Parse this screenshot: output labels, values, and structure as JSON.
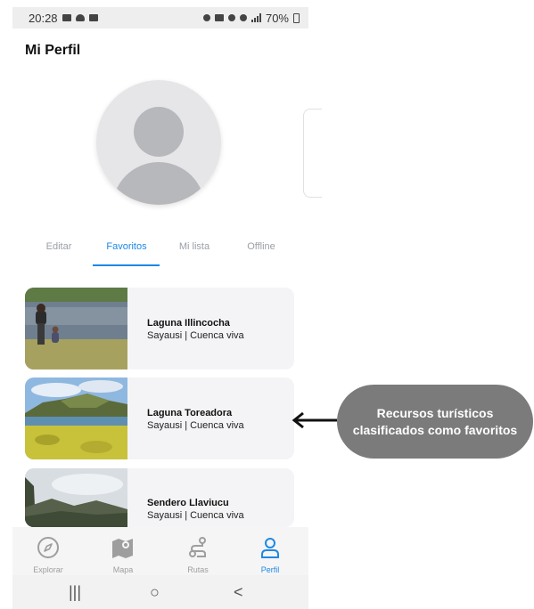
{
  "status_bar": {
    "time": "20:28",
    "battery": "70%"
  },
  "page_title": "Mi Perfil",
  "tabs": [
    {
      "label": "Editar",
      "active": false
    },
    {
      "label": "Favoritos",
      "active": true
    },
    {
      "label": "Mi lista",
      "active": false
    },
    {
      "label": "Offline",
      "active": false
    }
  ],
  "favorites": [
    {
      "title": "Laguna Illincocha",
      "subtitle": "Sayausi | Cuenca viva"
    },
    {
      "title": "Laguna Toreadora",
      "subtitle": "Sayausi | Cuenca viva"
    },
    {
      "title": "Sendero Llaviucu",
      "subtitle": "Sayausi | Cuenca viva"
    }
  ],
  "bottom_nav": [
    {
      "label": "Explorar",
      "icon": "compass-icon",
      "active": false
    },
    {
      "label": "Mapa",
      "icon": "map-icon",
      "active": false
    },
    {
      "label": "Rutas",
      "icon": "route-icon",
      "active": false
    },
    {
      "label": "Perfil",
      "icon": "person-icon",
      "active": true
    }
  ],
  "system_nav": {
    "recents": "|||",
    "home": "○",
    "back": "<"
  },
  "callout": {
    "text": "Recursos turísticos clasificados como favoritos"
  },
  "colors": {
    "accent": "#1e88e5",
    "callout_bg": "#7b7b7b",
    "card_bg": "#f4f4f6"
  }
}
